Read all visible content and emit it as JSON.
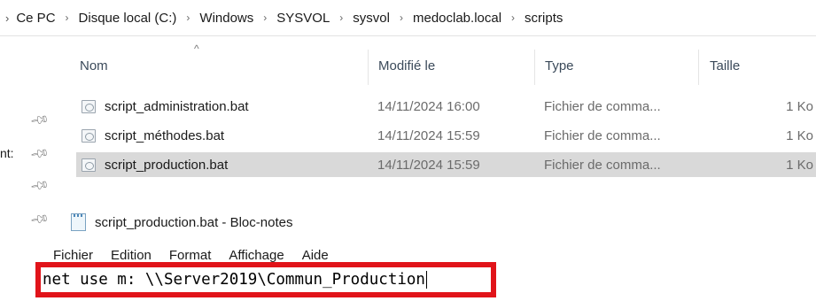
{
  "breadcrumb": {
    "lead_chevron": "›",
    "items": [
      "Ce PC",
      "Disque local (C:)",
      "Windows",
      "SYSVOL",
      "sysvol",
      "medoclab.local",
      "scripts"
    ],
    "separator": "›"
  },
  "leftpanel": {
    "partial_text": "nt:"
  },
  "filelist": {
    "sort_indicator": "^",
    "columns": {
      "name": "Nom",
      "modified": "Modifié le",
      "type": "Type",
      "size": "Taille"
    },
    "rows": [
      {
        "name": "script_administration.bat",
        "modified": "14/11/2024 16:00",
        "type": "Fichier de comma...",
        "size": "1 Ko",
        "selected": false
      },
      {
        "name": "script_méthodes.bat",
        "modified": "14/11/2024 15:59",
        "type": "Fichier de comma...",
        "size": "1 Ko",
        "selected": false
      },
      {
        "name": "script_production.bat",
        "modified": "14/11/2024 15:59",
        "type": "Fichier de comma...",
        "size": "1 Ko",
        "selected": true
      }
    ]
  },
  "notepad": {
    "title": "script_production.bat - Bloc-notes",
    "menu": [
      "Fichier",
      "Edition",
      "Format",
      "Affichage",
      "Aide"
    ],
    "content": "net use m: \\\\Server2019\\Commun_Production"
  },
  "colors": {
    "highlight_border": "#e1141a",
    "selected_row": "#d9d9d9"
  }
}
